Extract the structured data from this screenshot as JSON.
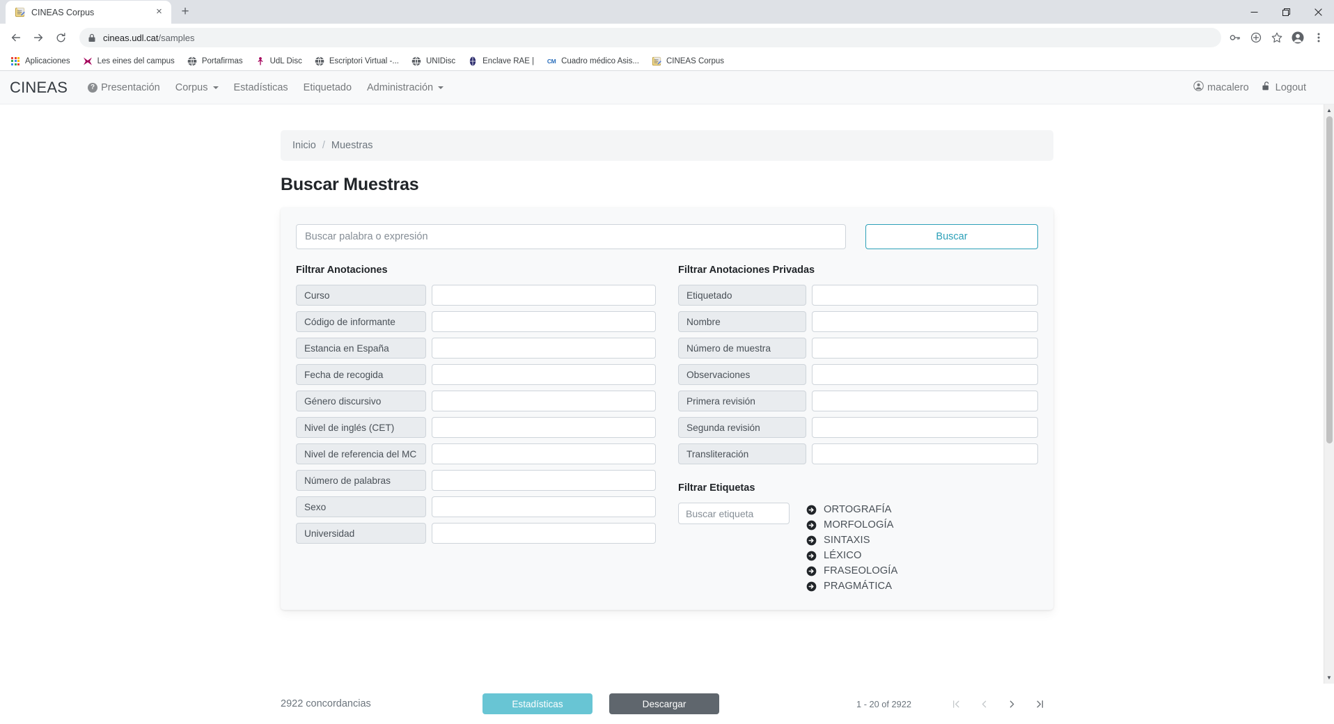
{
  "browser": {
    "tab": {
      "title": "CINEAS Corpus",
      "favicon": "memo-icon",
      "close_label": "×"
    },
    "new_tab_label": "+",
    "window_controls": {
      "minimize": "minimize-icon",
      "maximize": "maximize-icon",
      "close": "close-icon"
    },
    "nav": {
      "back": "back-arrow-icon",
      "forward": "forward-arrow-icon",
      "reload": "reload-icon"
    },
    "omnibox": {
      "lock": "lock-icon",
      "host": "cineas.udl.cat",
      "path": "/samples"
    },
    "toolbar_icons": [
      "key-icon",
      "plus-circle-icon",
      "star-icon",
      "profile-icon",
      "kebab-menu-icon"
    ],
    "bookmarks": [
      {
        "label": "Aplicaciones",
        "icon": "apps-grid-icon"
      },
      {
        "label": "Les eines del campus",
        "icon": "udl-star-icon"
      },
      {
        "label": "Portafirmas",
        "icon": "globe-icon"
      },
      {
        "label": "UdL Disc",
        "icon": "pin-icon"
      },
      {
        "label": "Escriptori Virtual -...",
        "icon": "globe-icon"
      },
      {
        "label": "UNIDisc",
        "icon": "globe-icon"
      },
      {
        "label": "Enclave RAE |",
        "icon": "rae-icon"
      },
      {
        "label": "Cuadro médico Asis...",
        "icon": "cm-icon"
      },
      {
        "label": "CINEAS Corpus",
        "icon": "memo-icon"
      }
    ]
  },
  "app": {
    "brand": "CINEAS",
    "nav_items": [
      {
        "label": "Presentación",
        "icon": "question-circle-icon",
        "caret": false
      },
      {
        "label": "Corpus",
        "icon": null,
        "caret": true
      },
      {
        "label": "Estadísticas",
        "icon": null,
        "caret": false
      },
      {
        "label": "Etiquetado",
        "icon": null,
        "caret": false
      },
      {
        "label": "Administración",
        "icon": null,
        "caret": true
      }
    ],
    "user": {
      "name": "macalero",
      "icon": "user-circle-icon"
    },
    "logout": {
      "label": "Logout",
      "icon": "unlock-icon"
    }
  },
  "breadcrumb": {
    "home": "Inicio",
    "separator": "/",
    "current": "Muestras"
  },
  "page_title": "Buscar Muestras",
  "search": {
    "placeholder": "Buscar palabra o expresión",
    "value": "",
    "button_label": "Buscar"
  },
  "annotations": {
    "title": "Filtrar Anotaciones",
    "rows": [
      {
        "label": "Curso",
        "value": ""
      },
      {
        "label": "Código de informante",
        "value": ""
      },
      {
        "label": "Estancia en España",
        "value": ""
      },
      {
        "label": "Fecha de recogida",
        "value": ""
      },
      {
        "label": "Género discursivo",
        "value": ""
      },
      {
        "label": "Nivel de inglés (CET)",
        "value": ""
      },
      {
        "label": "Nivel de referencia del MC",
        "value": ""
      },
      {
        "label": "Número de palabras",
        "value": ""
      },
      {
        "label": "Sexo",
        "value": ""
      },
      {
        "label": "Universidad",
        "value": ""
      }
    ]
  },
  "private_annotations": {
    "title": "Filtrar Anotaciones Privadas",
    "rows": [
      {
        "label": "Etiquetado",
        "value": ""
      },
      {
        "label": "Nombre",
        "value": ""
      },
      {
        "label": "Número de muestra",
        "value": ""
      },
      {
        "label": "Observaciones",
        "value": ""
      },
      {
        "label": "Primera revisión",
        "value": ""
      },
      {
        "label": "Segunda revisión",
        "value": ""
      },
      {
        "label": "Transliteración",
        "value": ""
      }
    ]
  },
  "tags": {
    "title": "Filtrar Etiquetas",
    "search_placeholder": "Buscar etiqueta",
    "search_value": "",
    "items": [
      {
        "label": "ORTOGRAFÍA",
        "icon": "arrow-right-circle-icon"
      },
      {
        "label": "MORFOLOGÍA",
        "icon": "arrow-right-circle-icon"
      },
      {
        "label": "SINTAXIS",
        "icon": "arrow-right-circle-icon"
      },
      {
        "label": "LÉXICO",
        "icon": "arrow-right-circle-icon"
      },
      {
        "label": "FRASEOLOGÍA",
        "icon": "arrow-right-circle-icon"
      },
      {
        "label": "PRAGMÁTICA",
        "icon": "arrow-right-circle-icon"
      }
    ]
  },
  "footer": {
    "concordances": "2922 concordancias",
    "stats_button": "Estadísticas",
    "download_button": "Descargar",
    "page_range": "1 - 20 of 2922",
    "pager": {
      "first": "first-page-icon",
      "prev": "previous-page-icon",
      "next": "next-page-icon",
      "last": "last-page-icon"
    }
  },
  "colors": {
    "accent_teal": "#2ca0b8",
    "stats_button": "#68c5d4",
    "download_button": "#5f666d",
    "card_bg": "#f8f9fa",
    "label_bg": "#e9ecef",
    "border": "#ced4da"
  }
}
